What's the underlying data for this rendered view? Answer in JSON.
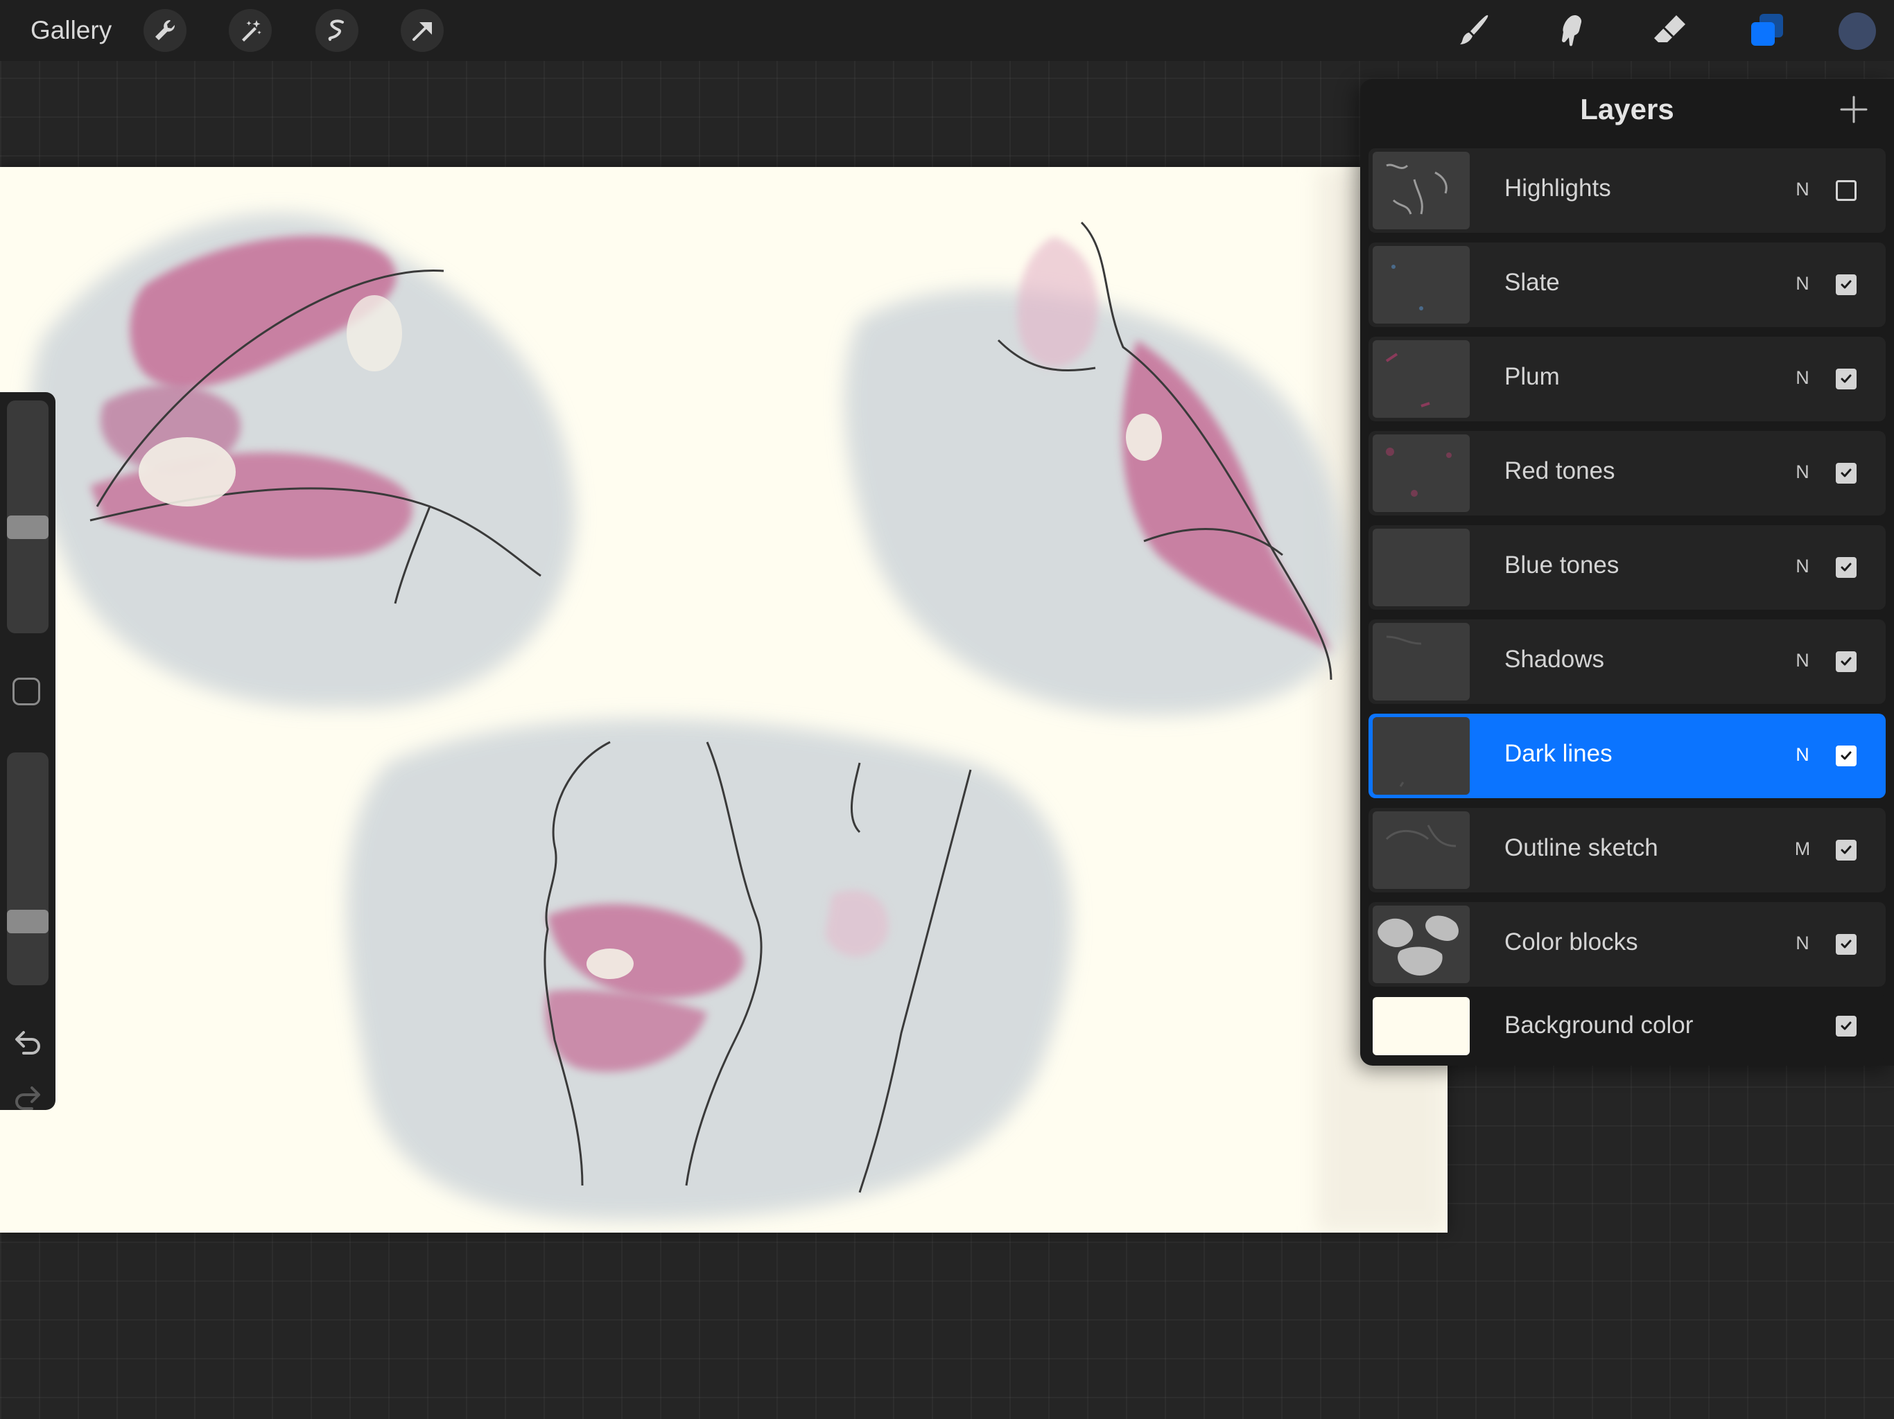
{
  "toolbar": {
    "gallery_label": "Gallery",
    "left_tools": [
      "wrench-icon",
      "magic-wand-icon",
      "selection-icon",
      "transform-arrow-icon"
    ],
    "right_tools": [
      "brush-icon",
      "smudge-icon",
      "eraser-icon",
      "layers-icon"
    ],
    "active_tool": "layers-icon",
    "current_color": "#3c4a68"
  },
  "sidebar": {
    "brush_size_level": 0.55,
    "opacity_level": 0.75
  },
  "layers": {
    "title": "Layers",
    "items": [
      {
        "name": "Highlights",
        "mode": "N",
        "visible": false,
        "active": false
      },
      {
        "name": "Slate",
        "mode": "N",
        "visible": true,
        "active": false
      },
      {
        "name": "Plum",
        "mode": "N",
        "visible": true,
        "active": false
      },
      {
        "name": "Red tones",
        "mode": "N",
        "visible": true,
        "active": false
      },
      {
        "name": "Blue tones",
        "mode": "N",
        "visible": true,
        "active": false
      },
      {
        "name": "Shadows",
        "mode": "N",
        "visible": true,
        "active": false
      },
      {
        "name": "Dark lines",
        "mode": "N",
        "visible": true,
        "active": true
      },
      {
        "name": "Outline sketch",
        "mode": "M",
        "visible": true,
        "active": false
      },
      {
        "name": "Color blocks",
        "mode": "N",
        "visible": true,
        "active": false
      }
    ],
    "background": {
      "name": "Background color",
      "visible": true,
      "color": "#fffcee"
    }
  },
  "colors": {
    "accent": "#0b74ff",
    "canvas_paper": "#fffdf0",
    "lip_pink": "#c4628f",
    "wash_gray": "#cfd6da"
  }
}
